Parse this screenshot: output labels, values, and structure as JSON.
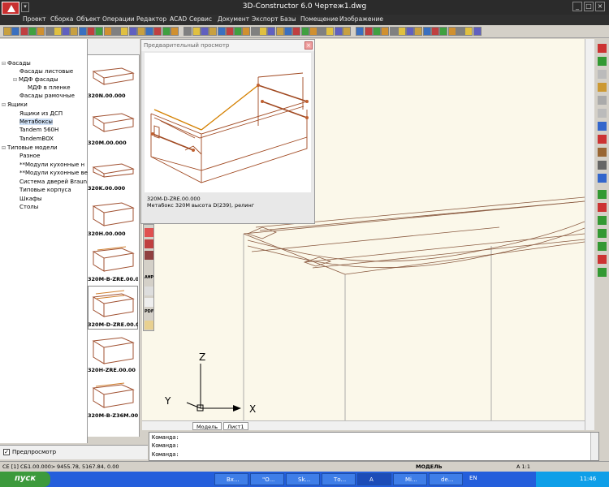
{
  "window": {
    "title": "3D-Constructor 6.0   Чертеж1.dwg"
  },
  "menu": [
    "Проект",
    "Сборка",
    "Объект",
    "Операции",
    "Редактор",
    "ACAD",
    "Сервис",
    "Документ",
    "Экспорт",
    "Базы",
    "Помещение",
    "Изображение"
  ],
  "tree": {
    "items": [
      {
        "label": "Фасады",
        "level": 0,
        "expander": "⊟"
      },
      {
        "label": "Фасады листовые",
        "level": 1,
        "expander": ""
      },
      {
        "label": "МДФ фасады",
        "level": 1,
        "expander": "⊟"
      },
      {
        "label": "МДФ в пленке",
        "level": 2,
        "expander": ""
      },
      {
        "label": "Фасады рамочные",
        "level": 1,
        "expander": ""
      },
      {
        "label": "Ящики",
        "level": 0,
        "expander": "⊟"
      },
      {
        "label": "Ящики из ДСП",
        "level": 1,
        "expander": ""
      },
      {
        "label": "Метабоксы",
        "level": 1,
        "expander": "",
        "selected": true
      },
      {
        "label": "Tandem 560H",
        "level": 1,
        "expander": ""
      },
      {
        "label": "TandemBOX",
        "level": 1,
        "expander": ""
      },
      {
        "label": "Типовые модели",
        "level": 0,
        "expander": "⊟"
      },
      {
        "label": "Разное",
        "level": 1,
        "expander": ""
      },
      {
        "label": "**Модули кухонные н",
        "level": 1,
        "expander": ""
      },
      {
        "label": "**Модули кухонные ве",
        "level": 1,
        "expander": ""
      },
      {
        "label": "Система дверей Braun",
        "level": 1,
        "expander": ""
      },
      {
        "label": "Типовые корпуса",
        "level": 1,
        "expander": ""
      },
      {
        "label": "Шкафы",
        "level": 1,
        "expander": ""
      },
      {
        "label": "Столы",
        "level": 1,
        "expander": ""
      }
    ]
  },
  "thumbnails": [
    {
      "label": "320N.00.000"
    },
    {
      "label": "320M.00.000"
    },
    {
      "label": "320K.00.000"
    },
    {
      "label": "320H.00.000"
    },
    {
      "label": "320M-B-ZRE.00.0"
    },
    {
      "label": "320M-D-ZRE.00.0"
    },
    {
      "label": "320H-ZRE.00.00"
    },
    {
      "label": "320M-B-Z36M.00"
    }
  ],
  "preview": {
    "title": "Предварительный просмотр",
    "caption_code": "320M-D-ZRE.00.000",
    "caption_desc": "Метабокс 320M высота D(239), релинг"
  },
  "axes": {
    "x": "X",
    "y": "Y",
    "z": "Z"
  },
  "vtools": [
    "A¥P",
    "PDF"
  ],
  "tabs": [
    "Модель",
    "Лист1"
  ],
  "command": {
    "lines": [
      "Команда:",
      "Команда:",
      "Команда:"
    ]
  },
  "preview_checkbox": {
    "label": "Предпросмотр",
    "checked": true
  },
  "status": {
    "left": "СЕ [1] СБ1.00.000>",
    "coords": "9455.78, 5167.84, 0.00",
    "mode": "МОДЕЛЬ",
    "scale": "A 1:1"
  },
  "taskbar": {
    "start": "пуск",
    "tasks": [
      "Вх...",
      "\"О...",
      "Sk...",
      "То...",
      "A",
      "Mi...",
      "de..."
    ],
    "lang": "EN",
    "clock": "11:46"
  },
  "colors": {
    "title_bg": "#2b2b2b",
    "drawing_bg": "#fbf8ea",
    "taskbar": "#245edb",
    "start": "#3c9a3c",
    "wire": "#8a5a40",
    "wire_hi": "#e0b000"
  }
}
